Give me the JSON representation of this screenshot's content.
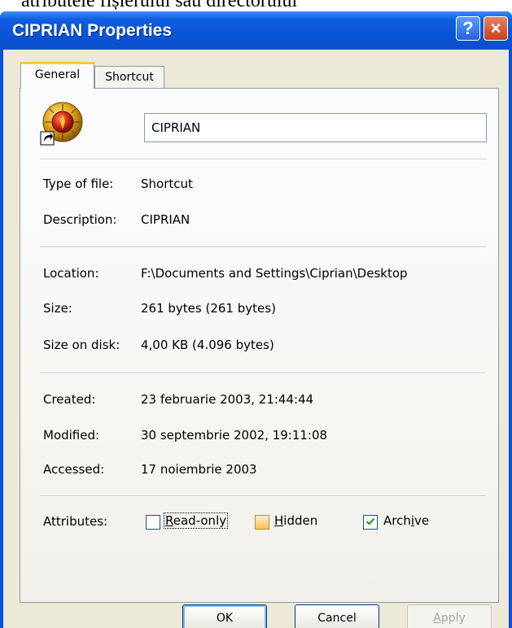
{
  "caption": "atributele fișierului sau directorului",
  "window": {
    "title": "CIPRIAN Properties",
    "help_glyph": "?",
    "close_glyph": "×"
  },
  "tabs": [
    {
      "label": "General",
      "active": true
    },
    {
      "label": "Shortcut",
      "active": false
    }
  ],
  "general": {
    "name": "CIPRIAN",
    "icon": "shortcut-file-icon",
    "rows": {
      "type": {
        "label": "Type of file:",
        "value": "Shortcut"
      },
      "description": {
        "label": "Description:",
        "value": "CIPRIAN"
      },
      "location": {
        "label": "Location:",
        "value": "F:\\Documents and Settings\\Ciprian\\Desktop"
      },
      "size": {
        "label": "Size:",
        "value": "261 bytes (261 bytes)"
      },
      "size_on_disk": {
        "label": "Size on disk:",
        "value": "4,00 KB (4.096 bytes)"
      },
      "created": {
        "label": "Created:",
        "value": "23 februarie 2003, 21:44:44"
      },
      "modified": {
        "label": "Modified:",
        "value": "30 septembrie 2002, 19:11:08"
      },
      "accessed": {
        "label": "Accessed:",
        "value": "17 noiembrie 2003"
      }
    },
    "attributes": {
      "label": "Attributes:",
      "readonly": {
        "pre": "",
        "key": "R",
        "post": "ead-only",
        "checked": false
      },
      "hidden": {
        "pre": "",
        "key": "H",
        "post": "idden",
        "checked": false
      },
      "archive": {
        "pre": "Arch",
        "key": "i",
        "post": "ve",
        "checked": true
      }
    }
  },
  "buttons": {
    "ok": "OK",
    "cancel": "Cancel",
    "apply": {
      "pre": "",
      "key": "A",
      "post": "pply"
    }
  }
}
